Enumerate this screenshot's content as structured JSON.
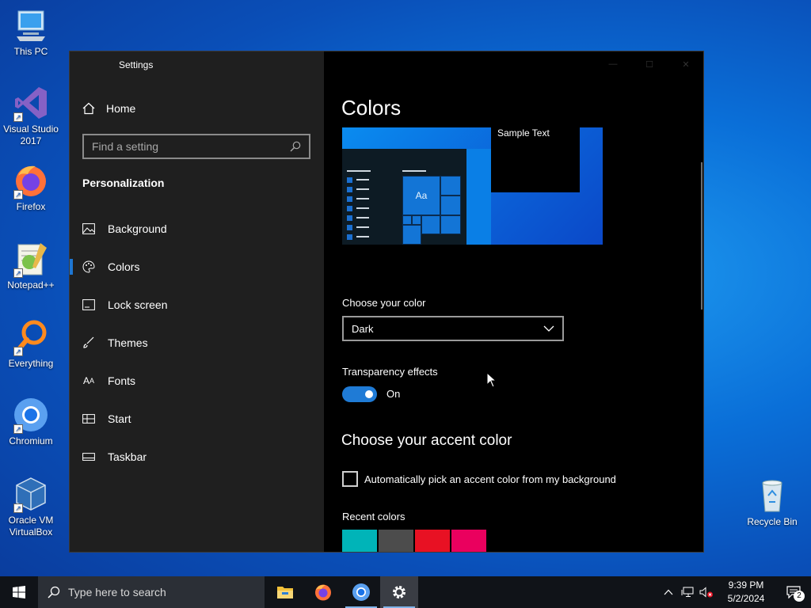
{
  "desktop": {
    "icons": [
      {
        "label": "This PC",
        "icon": "computer-icon"
      },
      {
        "label": "Visual Studio 2017",
        "icon": "visual-studio-icon"
      },
      {
        "label": "Firefox",
        "icon": "firefox-icon"
      },
      {
        "label": "Notepad++",
        "icon": "notepadpp-icon"
      },
      {
        "label": "Everything",
        "icon": "everything-search-icon"
      },
      {
        "label": "Chromium",
        "icon": "chromium-icon"
      },
      {
        "label": "Oracle VM VirtualBox",
        "icon": "virtualbox-icon"
      },
      {
        "label": "Recycle Bin",
        "icon": "recycle-bin-icon"
      }
    ]
  },
  "window": {
    "title": "Settings",
    "sidebar": {
      "home_label": "Home",
      "search_placeholder": "Find a setting",
      "section_title": "Personalization",
      "items": [
        {
          "label": "Background",
          "icon": "image-icon"
        },
        {
          "label": "Colors",
          "icon": "palette-icon",
          "active": true
        },
        {
          "label": "Lock screen",
          "icon": "lock-screen-icon"
        },
        {
          "label": "Themes",
          "icon": "brush-icon"
        },
        {
          "label": "Fonts",
          "icon": "font-icon"
        },
        {
          "label": "Start",
          "icon": "start-grid-icon"
        },
        {
          "label": "Taskbar",
          "icon": "taskbar-icon"
        }
      ]
    },
    "main": {
      "title": "Colors",
      "preview": {
        "sample_text": "Sample Text",
        "tile_text": "Aa"
      },
      "choose_color": {
        "label": "Choose your color",
        "value": "Dark"
      },
      "transparency": {
        "label": "Transparency effects",
        "state": "On",
        "on": true
      },
      "accent": {
        "heading": "Choose your accent color",
        "auto_pick_label": "Automatically pick an accent color from my background",
        "auto_pick_checked": false,
        "recent_label": "Recent colors",
        "recent_colors": [
          "#00b4b8",
          "#4c4c4c",
          "#e81123",
          "#ea005e"
        ]
      }
    }
  },
  "taskbar": {
    "search_placeholder": "Type here to search",
    "apps": [
      {
        "name": "file-explorer-icon"
      },
      {
        "name": "firefox-icon"
      },
      {
        "name": "chromium-icon"
      },
      {
        "name": "settings-gear-icon"
      }
    ],
    "clock": {
      "time": "9:39 PM",
      "date": "5/2/2024"
    },
    "notification_count": "2"
  }
}
